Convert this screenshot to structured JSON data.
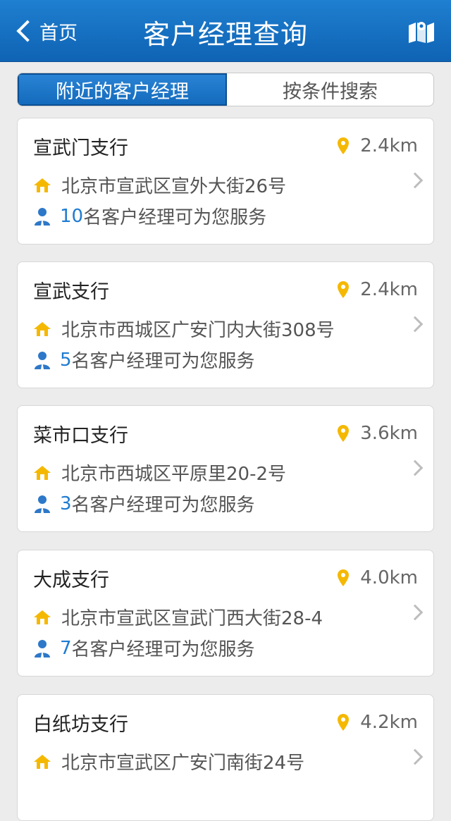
{
  "navbar": {
    "back_label": "首页",
    "title": "客户经理查询"
  },
  "segment": {
    "tabs": [
      {
        "label": "附近的客户经理",
        "active": true
      },
      {
        "label": "按条件搜索",
        "active": false
      }
    ]
  },
  "branches": [
    {
      "name": "宣武门支行",
      "distance": "2.4km",
      "address": "北京市宣武区宣外大街26号",
      "manager_count": "10",
      "manager_text": "名客户经理可为您服务"
    },
    {
      "name": "宣武支行",
      "distance": "2.4km",
      "address": "北京市西城区广安门内大街308号",
      "manager_count": "5",
      "manager_text": "名客户经理可为您服务"
    },
    {
      "name": "菜市口支行",
      "distance": "3.6km",
      "address": "北京市西城区平原里20-2号",
      "manager_count": "3",
      "manager_text": "名客户经理可为您服务"
    },
    {
      "name": "大成支行",
      "distance": "4.0km",
      "address": "北京市宣武区宣武门西大街28-4",
      "manager_count": "7",
      "manager_text": "名客户经理可为您服务"
    },
    {
      "name": "白纸坊支行",
      "distance": "4.2km",
      "address": "北京市宣武区广安门南街24号",
      "manager_count": "",
      "manager_text": ""
    }
  ],
  "colors": {
    "nav_blue": "#1670c2",
    "pin_yellow": "#f5b800",
    "count_blue": "#1f7bd1",
    "person_blue": "#2d78c8"
  }
}
